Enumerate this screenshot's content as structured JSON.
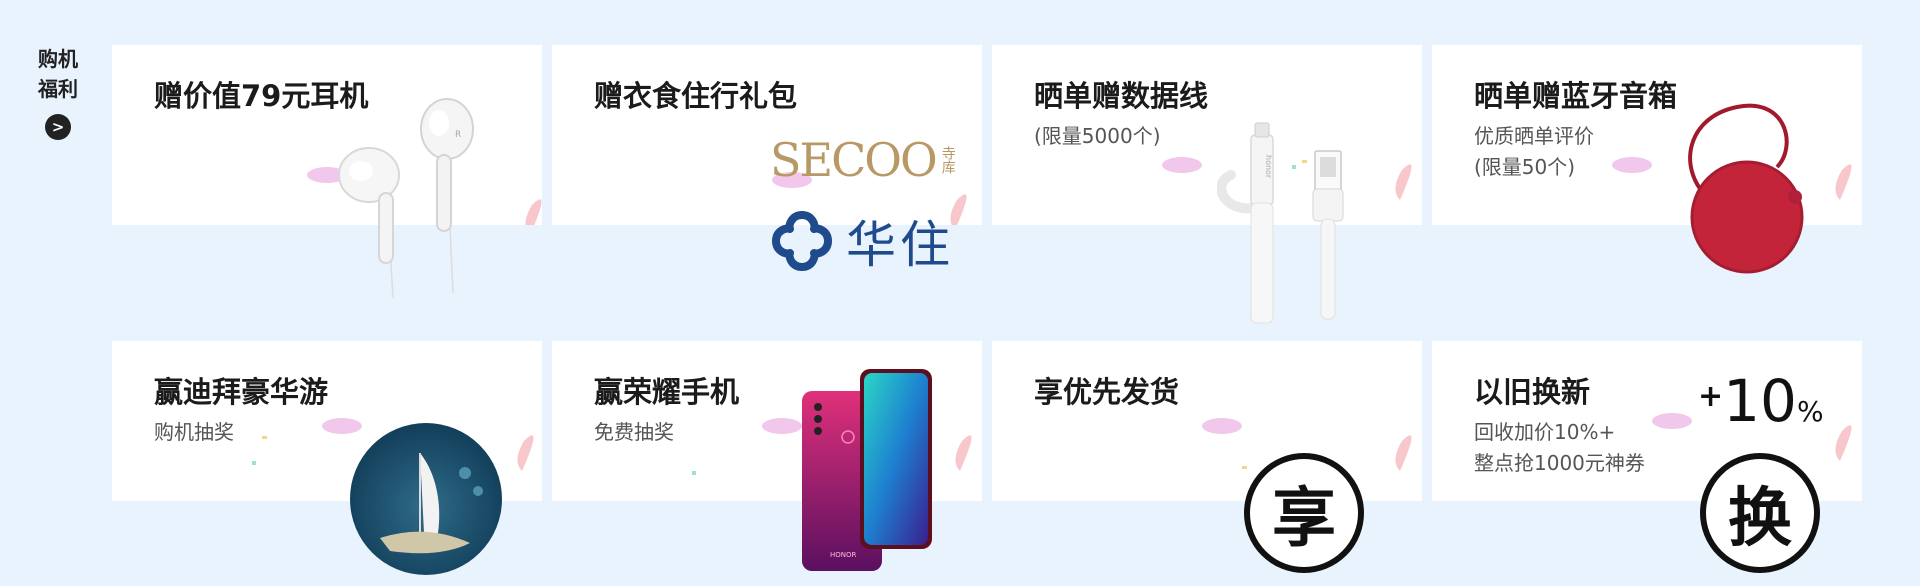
{
  "sidebar": {
    "title_line1": "购机",
    "title_line2": "福利",
    "more": ">"
  },
  "row1": [
    {
      "title": "赠价值79元耳机",
      "icon": "earphones-icon"
    },
    {
      "title": "赠衣食住行礼包",
      "brand1": "SECOO",
      "brand1_cn": "寺库",
      "brand2": "华住",
      "icon": "gift-pack-icon"
    },
    {
      "title": "晒单赠数据线",
      "sub1": "(限量5000个)",
      "cable_brand": "honor",
      "icon": "data-cable-icon"
    },
    {
      "title": "晒单赠蓝牙音箱",
      "sub1": "优质晒单评价",
      "sub2": "(限量50个)",
      "icon": "bluetooth-speaker-icon"
    }
  ],
  "row2": [
    {
      "title": "赢迪拜豪华游",
      "sub1": "购机抽奖",
      "icon": "dubai-travel-icon"
    },
    {
      "title": "赢荣耀手机",
      "sub1": "免费抽奖",
      "phone_brand": "HONOR",
      "icon": "honor-phone-icon"
    },
    {
      "title": "享优先发货",
      "badge": "享",
      "icon": "priority-badge-icon"
    },
    {
      "title": "以旧换新",
      "sub1": "回收加价10%+",
      "sub2": "整点抢1000元神券",
      "plus": "+",
      "num": "10",
      "pct": "%",
      "badge": "换",
      "icon": "trade-in-badge-icon"
    }
  ],
  "colors": {
    "background": "#e9f3fd",
    "card": "#ffffff",
    "speaker_red": "#c3243a",
    "huazhu_blue": "#1f4a8c",
    "secoo_gold": "#b89966"
  }
}
